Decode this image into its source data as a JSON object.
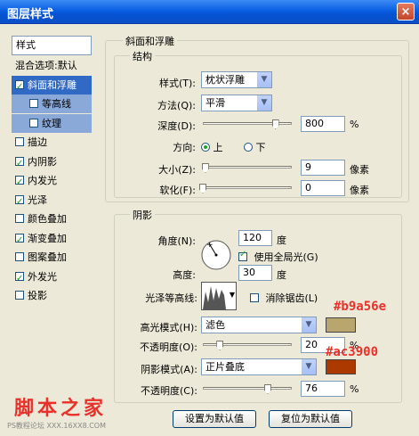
{
  "window": {
    "title": "图层样式",
    "close_glyph": "×"
  },
  "sidebar": {
    "header": "样式",
    "items": [
      {
        "label": "混合选项:默认",
        "checkbox": false,
        "checked": false
      },
      {
        "label": "斜面和浮雕",
        "checkbox": true,
        "checked": true
      },
      {
        "label": "等高线",
        "checkbox": true,
        "checked": false
      },
      {
        "label": "纹理",
        "checkbox": true,
        "checked": false
      },
      {
        "label": "描边",
        "checkbox": true,
        "checked": false
      },
      {
        "label": "内阴影",
        "checkbox": true,
        "checked": true
      },
      {
        "label": "内发光",
        "checkbox": true,
        "checked": true
      },
      {
        "label": "光泽",
        "checkbox": true,
        "checked": true
      },
      {
        "label": "颜色叠加",
        "checkbox": true,
        "checked": false
      },
      {
        "label": "渐变叠加",
        "checkbox": true,
        "checked": true
      },
      {
        "label": "图案叠加",
        "checkbox": true,
        "checked": false
      },
      {
        "label": "外发光",
        "checkbox": true,
        "checked": true
      },
      {
        "label": "投影",
        "checkbox": true,
        "checked": false
      }
    ]
  },
  "bevel": {
    "section_title": "斜面和浮雕",
    "structure_title": "结构",
    "style_label": "样式(T):",
    "style_value": "枕状浮雕",
    "technique_label": "方法(Q):",
    "technique_value": "平滑",
    "depth_label": "深度(D):",
    "depth_value": "800",
    "depth_unit": "%",
    "depth_level": 0.85,
    "direction_label": "方向:",
    "dir_up": "上",
    "dir_down": "下",
    "size_label": "大小(Z):",
    "size_value": "9",
    "size_unit": "像素",
    "size_level": 0.03,
    "soften_label": "软化(F):",
    "soften_value": "0",
    "soften_unit": "像素",
    "soften_level": 0.0
  },
  "shading": {
    "title": "阴影",
    "angle_label": "角度(N):",
    "angle_value": "120",
    "angle_unit": "度",
    "global_light_label": "使用全局光(G)",
    "global_light_checked": true,
    "altitude_label": "高度:",
    "altitude_value": "30",
    "altitude_unit": "度",
    "gloss_label": "光泽等高线:",
    "antialias_label": "消除锯齿(L)",
    "antialias_checked": false,
    "highlight_label": "高光模式(H):",
    "highlight_value": "滤色",
    "highlight_color": "#b9a56e",
    "highlight_annotation": "#b9a56e",
    "highlight_opacity_label": "不透明度(O):",
    "highlight_opacity_value": "20",
    "highlight_opacity_unit": "%",
    "highlight_opacity_level": 0.2,
    "shadow_label": "阴影模式(A):",
    "shadow_value": "正片叠底",
    "shadow_color": "#ac3900",
    "shadow_annotation": "#ac3900",
    "shadow_opacity_label": "不透明度(C):",
    "shadow_opacity_value": "76",
    "shadow_opacity_unit": "%",
    "shadow_opacity_level": 0.76
  },
  "buttons": {
    "make_default": "设置为默认值",
    "reset_default": "复位为默认值"
  },
  "watermark": {
    "text": "脚本之家",
    "sub": "PS教程论坛 XXX.16XX8.COM"
  },
  "colors": {
    "annotation": "#e8312a",
    "selection": "#316ac5",
    "title_bar": "#0a5fe3"
  }
}
